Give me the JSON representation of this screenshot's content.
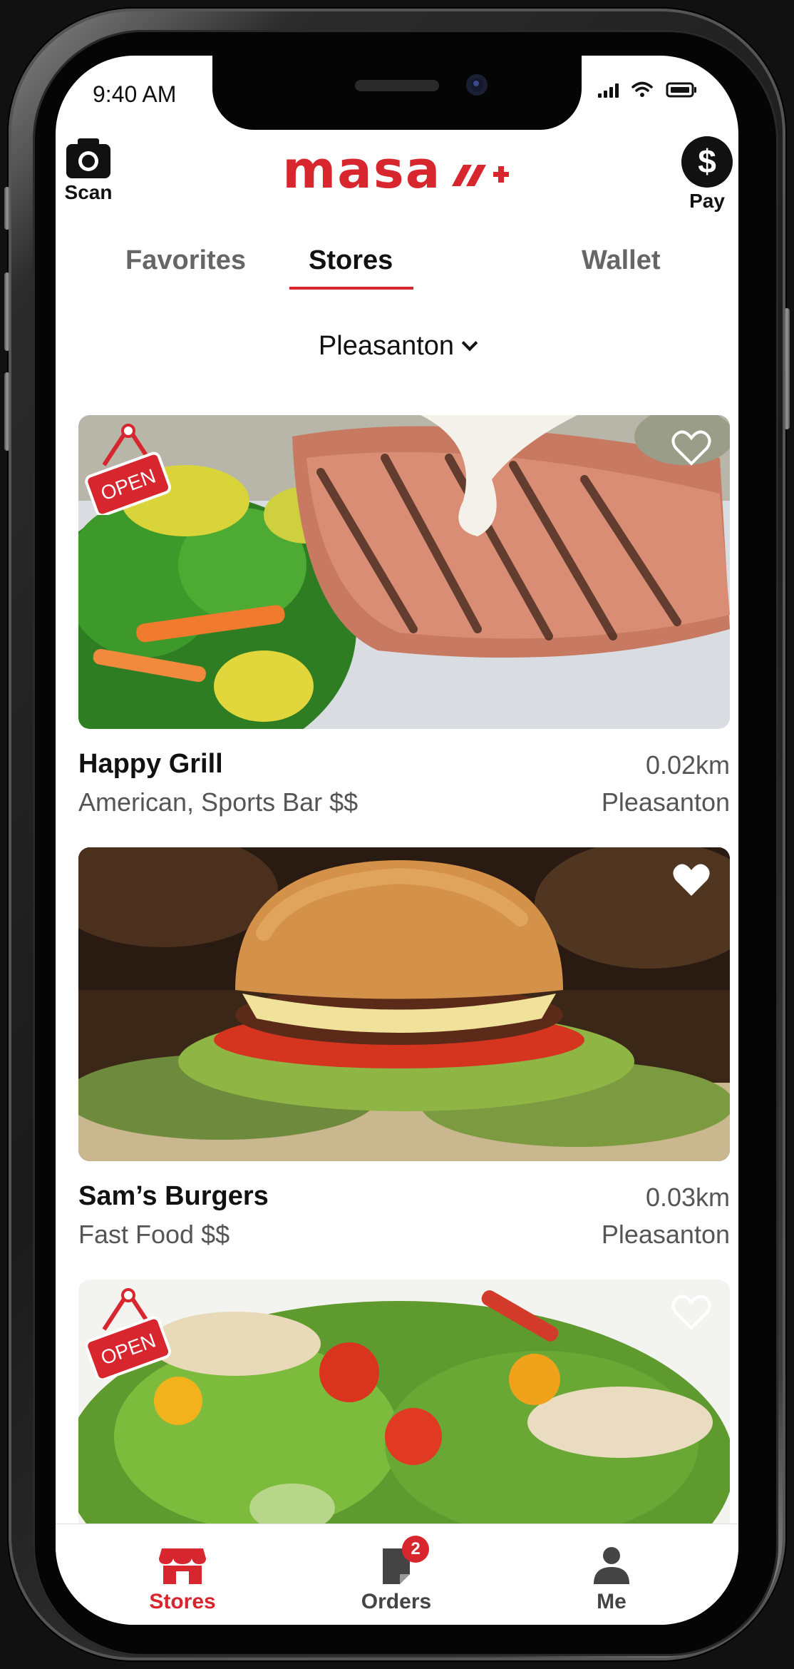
{
  "status_bar": {
    "time": "9:40 AM"
  },
  "header": {
    "scan_label": "Scan",
    "brand": "masa",
    "pay_label": "Pay"
  },
  "tabs": [
    {
      "label": "Favorites",
      "active": false
    },
    {
      "label": "Stores",
      "active": true
    },
    {
      "label": "Wallet",
      "active": false
    }
  ],
  "location": {
    "selected": "Pleasanton"
  },
  "stores": [
    {
      "name": "Happy Grill",
      "tags": "American, Sports Bar   $$",
      "distance": "0.02km",
      "city": "Pleasanton",
      "open": true,
      "favorite": false,
      "open_label": "OPEN"
    },
    {
      "name": "Sam’s Burgers",
      "tags": "Fast Food   $$",
      "distance": "0.03km",
      "city": "Pleasanton",
      "open": false,
      "favorite": true
    },
    {
      "open": true,
      "favorite": false,
      "open_label": "OPEN"
    }
  ],
  "bottom_nav": [
    {
      "label": "Stores",
      "active": true
    },
    {
      "label": "Orders",
      "active": false,
      "badge": "2"
    },
    {
      "label": "Me",
      "active": false
    }
  ],
  "colors": {
    "brand_red": "#d7262e",
    "text_dark": "#111111",
    "text_muted": "#555555"
  }
}
